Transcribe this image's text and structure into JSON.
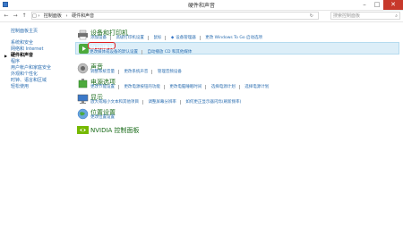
{
  "window": {
    "title": "硬件和声音"
  },
  "nav": {
    "back": "←",
    "forward": "→",
    "up": "↑",
    "breadcrumb": [
      "控制面板",
      "硬件和声音"
    ],
    "search_placeholder": "搜索控制面板"
  },
  "sidebar": {
    "home": "控制面板主页",
    "items": [
      "系统和安全",
      "网络和 Internet",
      "硬件和声音",
      "程序",
      "用户帐户和家庭安全",
      "外观和个性化",
      "时钟、语言和区域",
      "轻松使用"
    ],
    "current_index": 2
  },
  "categories": [
    {
      "title": "设备和打印机",
      "links": [
        "添加设备",
        "高级打印机设置",
        "鼠标",
        "设备管理器",
        "更改 Windows To Go 启动选项"
      ]
    },
    {
      "title": "自动播放",
      "links": [
        "更改媒体或设备的默认设置",
        "自动播放 CD 和其他媒体"
      ],
      "selected": true
    },
    {
      "title": "声音",
      "links": [
        "调整系统音量",
        "更改系统声音",
        "管理音频设备"
      ]
    },
    {
      "title": "电源选项",
      "links": [
        "更改节能设置",
        "更改电源按钮的功能",
        "更改电脑睡眠时间",
        "选择电源计划",
        "选择电源计划"
      ]
    },
    {
      "title": "显示",
      "links": [
        "放大或缩小文本和其他项目",
        "调整屏幕分辨率",
        "如何更正显示器闪烁(刷新频率)"
      ]
    },
    {
      "title": "位置设置",
      "links": [
        "更改位置设置"
      ]
    },
    {
      "title": "NVIDIA 控制面板",
      "links": []
    }
  ],
  "colors": {
    "link": "#2a6db0",
    "category": "#1a6b1a",
    "highlight": "#dceef8",
    "annotation": "#e02020",
    "close": "#c7392b"
  }
}
